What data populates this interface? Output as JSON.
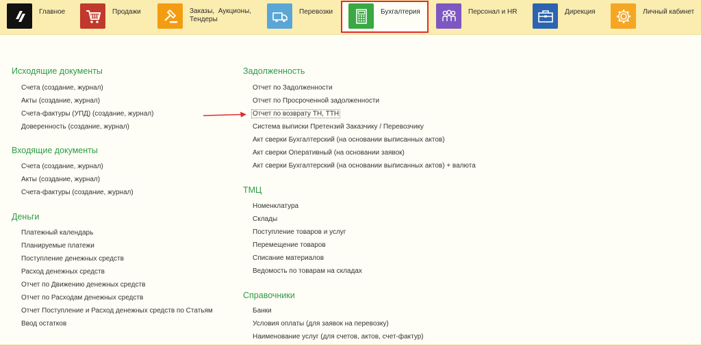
{
  "nav": {
    "items": [
      {
        "label": "Главное",
        "icon": "logo-icon",
        "color": "#111111"
      },
      {
        "label": "Продажи",
        "icon": "cart-icon",
        "color": "#c0392b"
      },
      {
        "label": "Заказы,  Аукционы,\nТендеры",
        "icon": "gavel-icon",
        "color": "#f39c12"
      },
      {
        "label": "Перевозки",
        "icon": "truck-icon",
        "color": "#5aa6d6"
      },
      {
        "label": "Бухгалтерия",
        "icon": "calculator-icon",
        "color": "#3aa843"
      },
      {
        "label": "Персонал и HR",
        "icon": "people-icon",
        "color": "#7e57c2"
      },
      {
        "label": "Дирекция",
        "icon": "briefcase-icon",
        "color": "#2c64b0"
      },
      {
        "label": "Личный кабинет",
        "icon": "gear-icon",
        "color": "#f5a623"
      }
    ],
    "selected": "Бухгалтерия"
  },
  "col1": {
    "s1": {
      "title": "Исходящие документы",
      "links": [
        "Счета (создание, журнал)",
        "Акты (создание, журнал)",
        "Счета-фактуры (УПД) (создание, журнал)",
        "Доверенность (создание, журнал)"
      ]
    },
    "s2": {
      "title": "Входящие документы",
      "links": [
        "Счета (создание, журнал)",
        "Акты (создание, журнал)",
        "Счета-фактуры (создание, журнал)"
      ]
    },
    "s3": {
      "title": "Деньги",
      "links": [
        "Платежный календарь",
        "Планируемые платежи",
        "Поступление денежных средств",
        "Расход денежных средств",
        "Отчет по Движению денежных средств",
        "Отчет по Расходам денежных средств",
        "Отчет Поступление и Расход денежных средств по Статьям",
        "Ввод остатков"
      ]
    }
  },
  "col2": {
    "s1": {
      "title": "Задолженность",
      "links": [
        "Отчет по Задолженности",
        "Отчет по Просроченной задолженности",
        "Отчет по возврату ТН, ТТН",
        "Система выписки Претензий Заказчику / Перевозчику",
        "Акт сверки Бухгалтерский (на основании выписанных актов)",
        "Акт сверки Оперативный (на основании заявок)",
        "Акт сверки Бухгалтерский (на основании выписанных актов) + валюта"
      ]
    },
    "s2": {
      "title": "ТМЦ",
      "links": [
        "Номенклатура",
        "Склады",
        "Поступление товаров и услуг",
        "Перемещение товаров",
        "Списание материалов",
        "Ведомость по товарам на складах"
      ]
    },
    "s3": {
      "title": "Справочники",
      "links": [
        "Банки",
        "Условия оплаты (для заявок на перевозку)",
        "Наименование услуг (для счетов, актов, счет-фактур)"
      ]
    }
  },
  "highlight_color": "#e02b2b"
}
